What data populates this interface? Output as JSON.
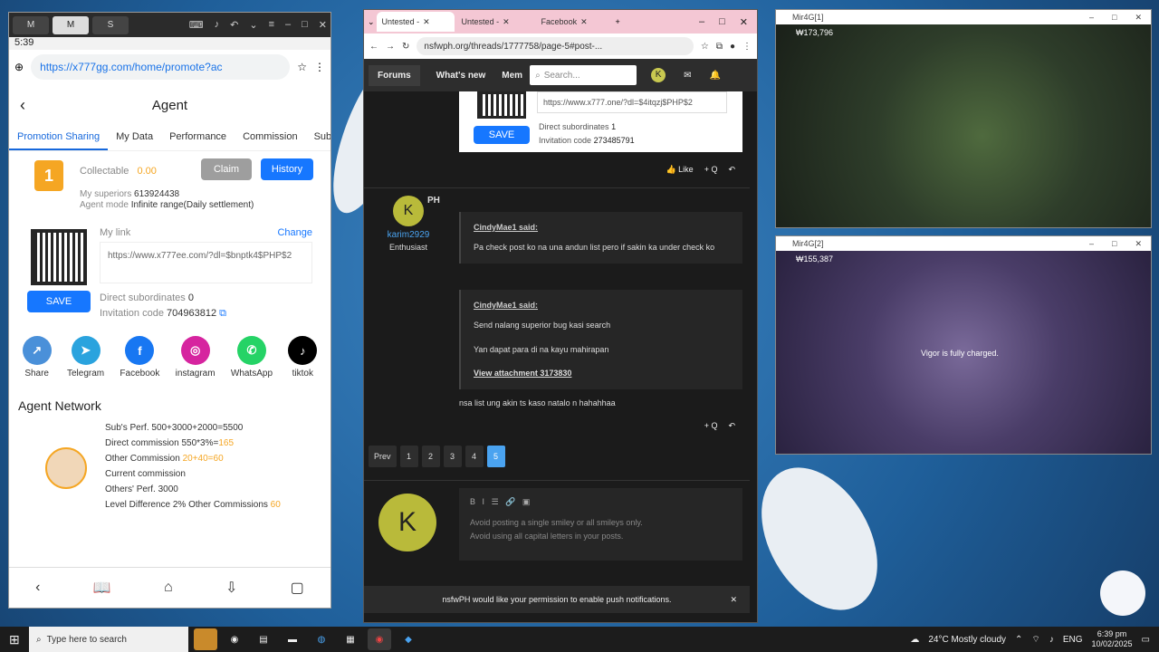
{
  "phone": {
    "top_tabs": [
      "M",
      "M",
      "S"
    ],
    "time": "5:39",
    "url": "https://x777gg.com/home/promote?ac",
    "title": "Agent",
    "tabs": [
      "Promotion Sharing",
      "My Data",
      "Performance",
      "Commission",
      "Subo"
    ],
    "collectable_label": "Collectable",
    "collectable_value": "0.00",
    "claim": "Claim",
    "history": "History",
    "superiors_label": "My superiors",
    "superiors_value": "613924438",
    "mode_label": "Agent mode",
    "mode_value": "Infinite range(Daily settlement)",
    "medal": "1",
    "mylink": "My link",
    "change": "Change",
    "link": "https://www.x777ee.com/?dl=$bnptk4$PHP$2",
    "save": "SAVE",
    "direct_label": "Direct subordinates",
    "direct_value": "0",
    "invite_label": "Invitation code",
    "invite_value": "704963812",
    "social": [
      {
        "label": "Share",
        "color": "#4a90d9",
        "glyph": "↗"
      },
      {
        "label": "Telegram",
        "color": "#2aa3de",
        "glyph": "➤"
      },
      {
        "label": "Facebook",
        "color": "#1877f2",
        "glyph": "f"
      },
      {
        "label": "instagram",
        "color": "#d6249f",
        "glyph": "◎"
      },
      {
        "label": "WhatsApp",
        "color": "#25d366",
        "glyph": "✆"
      },
      {
        "label": "tiktok",
        "color": "#000000",
        "glyph": "♪"
      }
    ],
    "network_title": "Agent Network",
    "net": {
      "subs_perf": "Sub's Perf. 500+3000+2000=5500",
      "direct_comm_a": "Direct commission 550*3%=",
      "direct_comm_b": "165",
      "other_comm_a": "Other Commission ",
      "other_comm_b": "20+40=60",
      "current": "Current commission",
      "others_perf": "Others' Perf. 3000",
      "level_a": "Level Difference 2% Other Commissions ",
      "level_b": "60"
    }
  },
  "browser": {
    "tabs": [
      "Untested -",
      "Untested -",
      "Facebook"
    ],
    "url": "nsfwph.org/threads/1777758/page-5#post-...",
    "nav": {
      "forums": "Forums",
      "whatsnew": "What's new",
      "more": "Mem",
      "search": "Search..."
    },
    "sig": {
      "link": "https://www.x777.one/?dl=$4itqzj$PHP$2",
      "save": "SAVE",
      "direct_label": "Direct subordinates",
      "direct_value": "1",
      "invite_label": "Invitation code",
      "invite_value": "273485791"
    },
    "like": "Like",
    "quote": "+ Q",
    "user": {
      "initial": "K",
      "name": "karim2929",
      "title": "Enthusiast",
      "country": "PH"
    },
    "q1": {
      "who": "CindyMae1 said:",
      "text": "Pa check post ko na una andun list pero if sakin ka under check ko"
    },
    "q2": {
      "who": "CindyMae1 said:",
      "l1": "Send nalang superior bug kasi search",
      "l2": "Yan dapat para di na kayu mahirapan",
      "att": "View attachment 3173830"
    },
    "reply": "nsa list ung akin ts kaso natalo n hahahhaa",
    "pages": [
      "Prev",
      "1",
      "2",
      "3",
      "4",
      "5"
    ],
    "editor_initial": "K",
    "ed1": "Avoid posting a single smiley or all smileys only.",
    "ed2": "Avoid using all capital letters in your posts.",
    "notif": "nsfwPH would like your permission to enable push notifications."
  },
  "game1": {
    "title": "Mir4G[1]",
    "coin": "173,796"
  },
  "game2": {
    "title": "Mir4G[2]",
    "coin": "155,387",
    "msg": "Vigor is fully charged."
  },
  "taskbar": {
    "search": "Type here to search",
    "weather": "24°C  Mostly cloudy",
    "lang": "ENG",
    "time": "6:39 pm",
    "date": "10/02/2025"
  }
}
